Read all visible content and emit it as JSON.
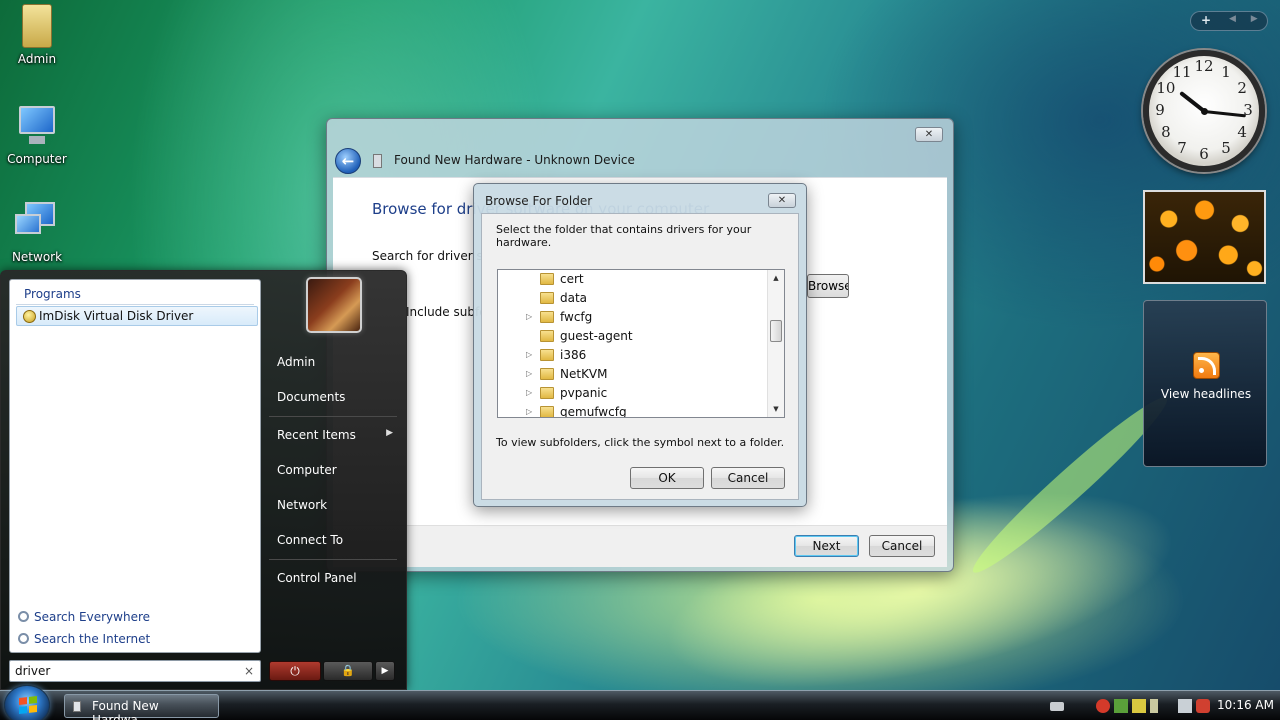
{
  "desktop": {
    "icons": [
      {
        "label": "Admin"
      },
      {
        "label": "Computer"
      },
      {
        "label": "Network"
      }
    ]
  },
  "wizard": {
    "close_glyph": "✕",
    "back_glyph": "←",
    "title": "Found New Hardware - Unknown Device",
    "heading": "Browse for driver software on your computer",
    "search_label": "Search for driver software in this location:",
    "browse_label": "Browse...",
    "include_label": "Include subfolders",
    "next_label": "Next",
    "cancel_label": "Cancel"
  },
  "browse_dialog": {
    "title": "Browse For Folder",
    "close_glyph": "✕",
    "description": "Select the folder that contains drivers for your hardware.",
    "folders": [
      {
        "name": "cert",
        "expandable": false
      },
      {
        "name": "data",
        "expandable": false
      },
      {
        "name": "fwcfg",
        "expandable": true
      },
      {
        "name": "guest-agent",
        "expandable": false
      },
      {
        "name": "i386",
        "expandable": true
      },
      {
        "name": "NetKVM",
        "expandable": true
      },
      {
        "name": "pvpanic",
        "expandable": true
      },
      {
        "name": "qemufwcfg",
        "expandable": true
      }
    ],
    "expand_glyph": "▷",
    "scroll_up_glyph": "▲",
    "scroll_down_glyph": "▼",
    "hint": "To view subfolders, click the symbol next to a folder.",
    "ok_label": "OK",
    "cancel_label": "Cancel"
  },
  "start_menu": {
    "section": "Programs",
    "results": [
      {
        "label": "ImDisk Virtual Disk Driver"
      }
    ],
    "search_everywhere": "Search Everywhere",
    "search_internet": "Search the Internet",
    "search_value": "driver",
    "clear_glyph": "×",
    "right_items": [
      {
        "label": "Admin",
        "has_arrow": false
      },
      {
        "label": "Documents",
        "has_arrow": false
      },
      {
        "label": "Recent Items",
        "has_arrow": true
      },
      {
        "label": "Computer",
        "has_arrow": false
      },
      {
        "label": "Network",
        "has_arrow": false
      },
      {
        "label": "Connect To",
        "has_arrow": false
      },
      {
        "label": "Control Panel",
        "has_arrow": false
      }
    ],
    "arrow_glyph": "▶",
    "power_glyph": "⏻",
    "lock_glyph": "🔒",
    "more_glyph": "▶"
  },
  "sidebar": {
    "add_glyph": "+",
    "nav_glyphs": "◀ ▶",
    "clock": {
      "numbers": [
        "12",
        "1",
        "2",
        "3",
        "4",
        "5",
        "6",
        "7",
        "8",
        "9",
        "10",
        "11"
      ],
      "hour": 10,
      "minute": 16
    },
    "feed_label": "View headlines"
  },
  "taskbar": {
    "task_label": "Found New Hardwa...",
    "time": "10:16 AM"
  },
  "colors": {
    "accent_blue": "#1e3f8a",
    "default_button_border": "#3c7fb1"
  }
}
